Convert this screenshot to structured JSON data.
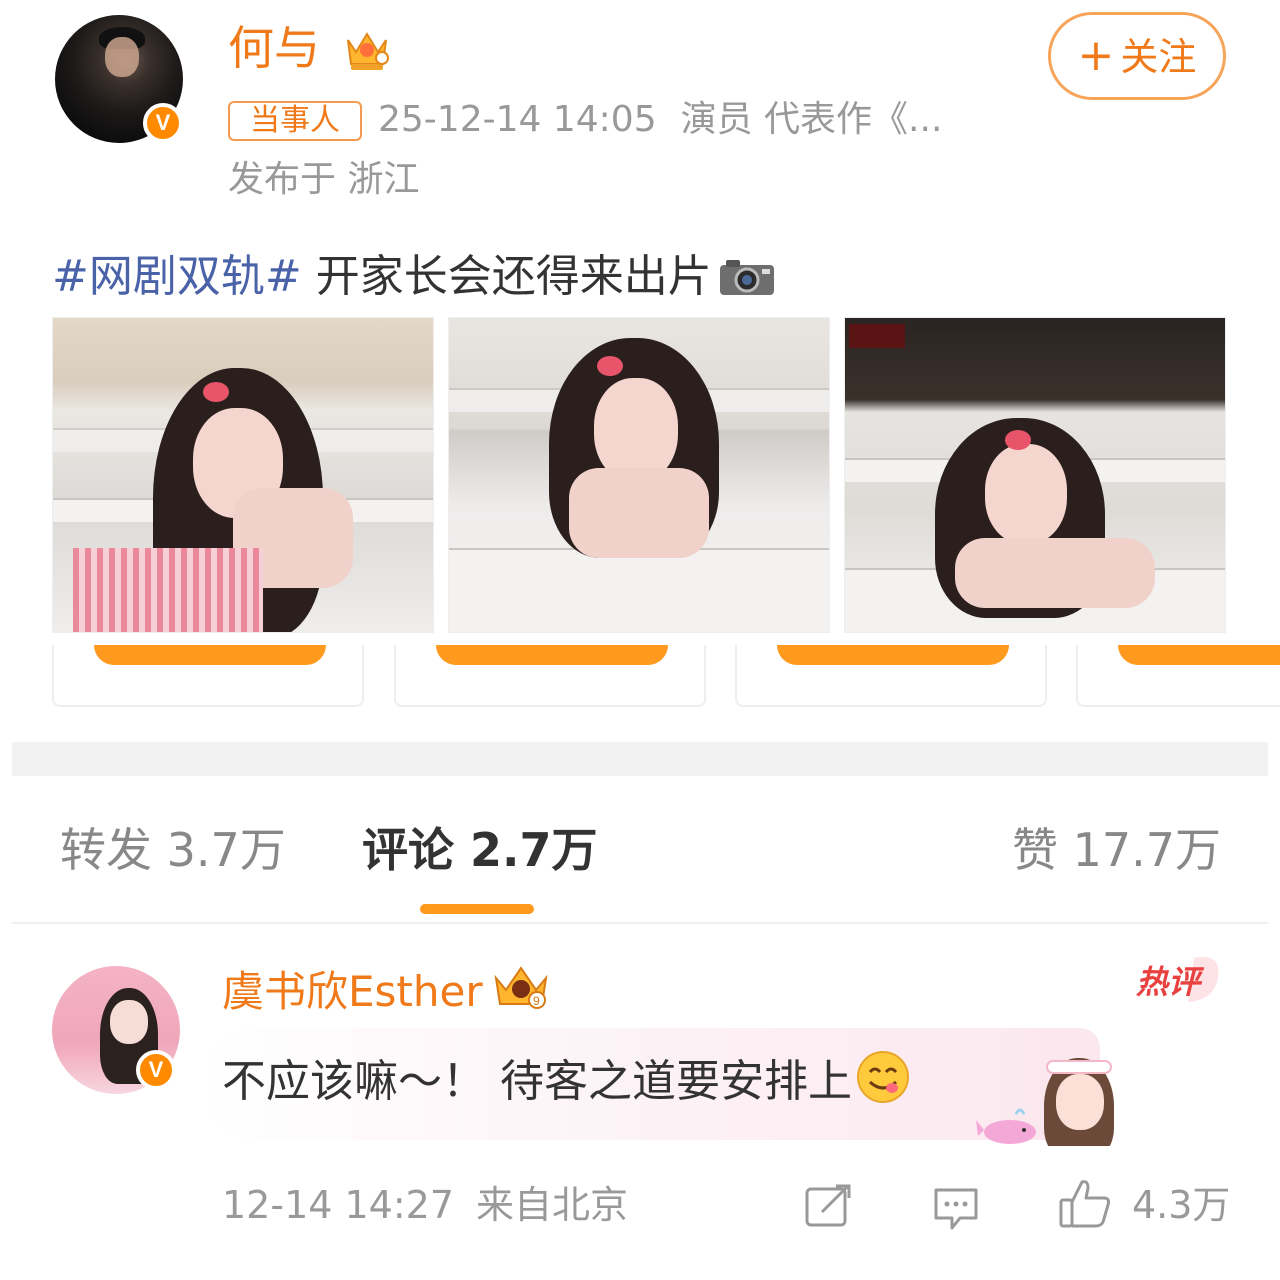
{
  "post": {
    "author": {
      "name": "何与",
      "avatar_icon": "verified-v-icon",
      "crown_icon": "member-crown-icon"
    },
    "follow_label": "+关注",
    "follow_plus": "+",
    "follow_text": "关注",
    "tag": "当事人",
    "time": "25-12-14 14:05",
    "bio": "演员 代表作《...",
    "location": "发布于 浙江",
    "hashtag": "#网剧双轨#",
    "text": " 开家长会还得来出片",
    "images": 3,
    "accent_color": "#f07a1a",
    "hashtag_color": "#4a63a8"
  },
  "tabs": {
    "repost": "转发 3.7万",
    "comments": "评论 2.7万",
    "likes": "赞 17.7万",
    "active": "comments",
    "underline_color": "#ff9a1e"
  },
  "comment": {
    "author": "虞书欣Esther",
    "badge": "热评",
    "text": "不应该嘛～！ 待客之道要安排上",
    "time": "12-14 14:27",
    "source": "来自北京",
    "likes": "4.3万"
  }
}
